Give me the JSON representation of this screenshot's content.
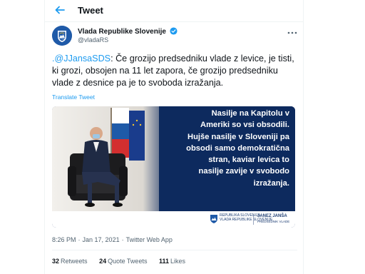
{
  "header": {
    "title": "Tweet",
    "back_icon": "arrow-left-icon"
  },
  "author": {
    "name": "Vlada Republike Slovenije",
    "handle": "@vladaRS",
    "verified_icon": "verified-badge-icon",
    "avatar_icon": "coat-of-arms-icon"
  },
  "tweet": {
    "mention": ".@JJansaSDS",
    "text": ": Če grozijo predsedniku vlade z levice, je tisti, ki grozi, obsojen na 11 let zapora, če grozijo predsedniku vlade z desnice pa je to svoboda izražanja.",
    "translate_label": "Translate Tweet"
  },
  "media": {
    "quote_lines": [
      "Nasilje na Kapitolu v",
      "Ameriki so vsi obsodili.",
      "Hujše nasilje v Sloveniji pa",
      "obsodi samo demokratična",
      "stran, kaviar levica to",
      "nasilje zavije v svobodo",
      "izražanja."
    ],
    "footer_org_line1": "REPUBLIKA SLOVENIJA",
    "footer_org_line2": "VLADA REPUBLIKE SLOVENIJE",
    "footer_name": "JANEZ JANŠA",
    "footer_role": "PREDSEDNIK VLADE"
  },
  "meta": {
    "time": "8:26 PM",
    "date": "Jan 17, 2021",
    "source": "Twitter Web App"
  },
  "stats": {
    "retweets_count": "32",
    "retweets_label": "Retweets",
    "quotes_count": "24",
    "quotes_label": "Quote Tweets",
    "likes_count": "111",
    "likes_label": "Likes"
  },
  "colors": {
    "accent": "#1d9bf0",
    "secondary_text": "#536471",
    "media_background": "#0d2a5e"
  }
}
